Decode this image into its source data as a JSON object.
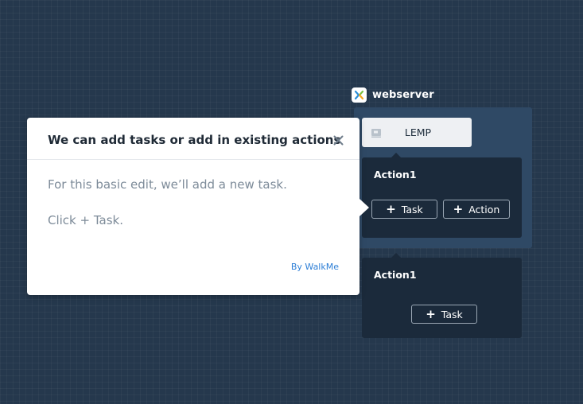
{
  "service": {
    "name": "webserver",
    "package": "LEMP",
    "logo_icon": "service-logo-icon",
    "package_icon": "package-icon"
  },
  "actions": [
    {
      "title": "Action1",
      "task_label": "Task",
      "action_label": "Action"
    },
    {
      "title": "Action1",
      "task_label": "Task"
    }
  ],
  "tooltip": {
    "title": "We can add tasks or add in existing actions",
    "body_line1": "For this basic edit, we’ll add a new task.",
    "body_line2": "Click + Task.",
    "brand": "By WalkMe",
    "close_icon": "close-icon"
  },
  "colors": {
    "background": "#25384d",
    "panel": "#2f4965",
    "card": "#1b2a3b",
    "accent": "#2e7fd6"
  }
}
